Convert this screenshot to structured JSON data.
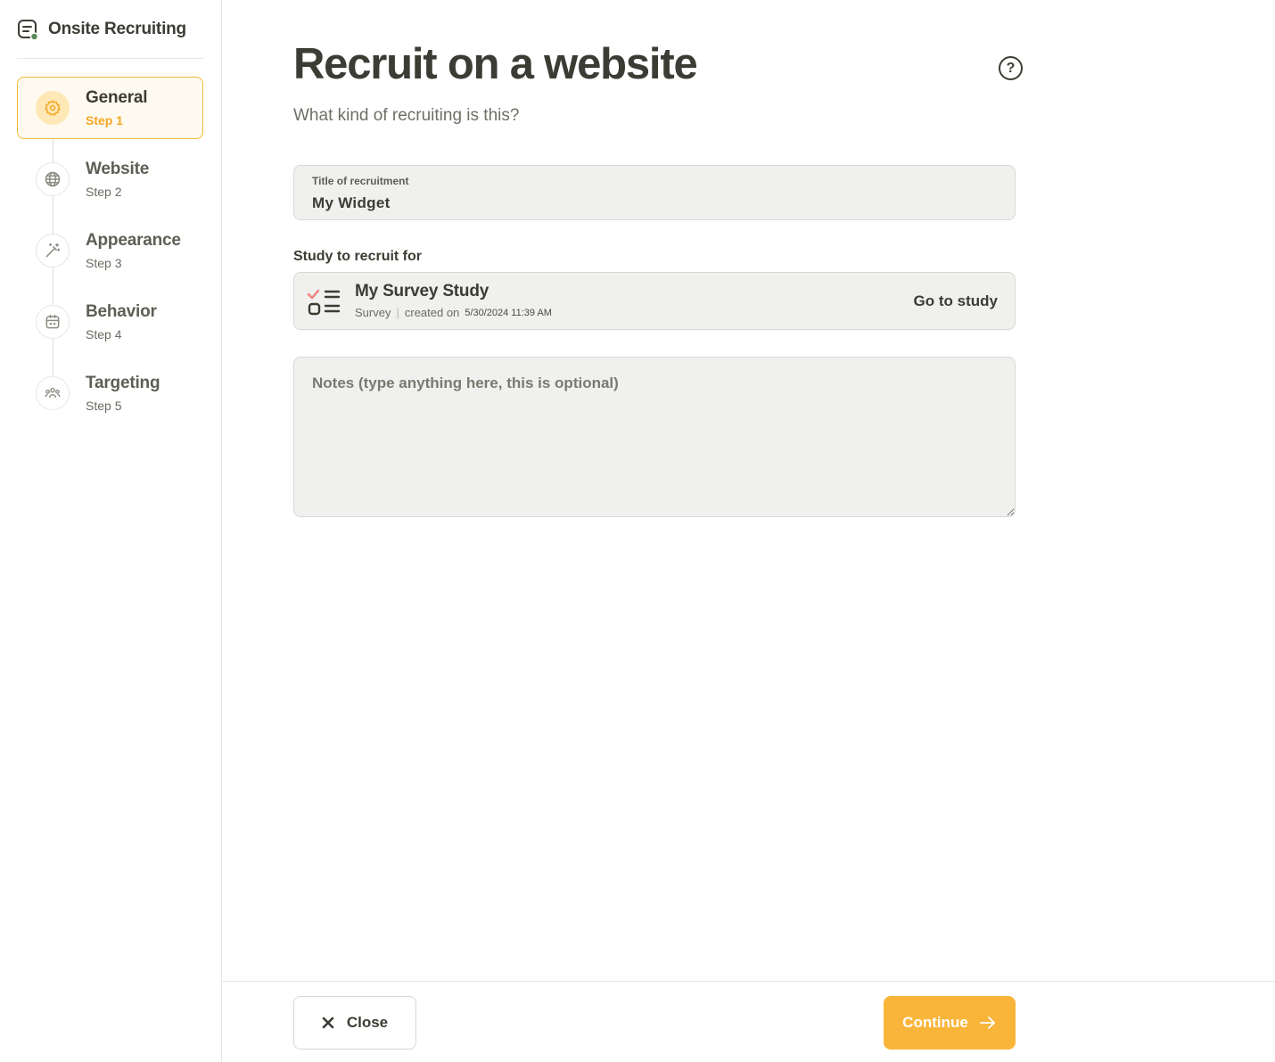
{
  "app": {
    "title": "Onsite Recruiting",
    "icon": "chat-form-icon"
  },
  "sidebar": {
    "steps": [
      {
        "name": "General",
        "sub": "Step 1",
        "icon": "gear-icon",
        "active": true
      },
      {
        "name": "Website",
        "sub": "Step 2",
        "icon": "globe-icon",
        "active": false
      },
      {
        "name": "Appearance",
        "sub": "Step 3",
        "icon": "magic-wand-icon",
        "active": false
      },
      {
        "name": "Behavior",
        "sub": "Step 4",
        "icon": "calendar-icon",
        "active": false
      },
      {
        "name": "Targeting",
        "sub": "Step 5",
        "icon": "people-group-icon",
        "active": false
      }
    ]
  },
  "main": {
    "title": "Recruit on a website",
    "subtitle": "What kind of recruiting is this?",
    "help_icon": "question-circle-icon",
    "title_field": {
      "label": "Title of recruitment",
      "value": "My Widget"
    },
    "study": {
      "label": "Study to recruit for",
      "name": "My Survey Study",
      "type": "Survey",
      "separator": "|",
      "created_prefix": "created on",
      "created_date": "5/30/2024 11:39 AM",
      "link": "Go to study",
      "icon": "survey-checklist-icon"
    },
    "notes": {
      "placeholder": "Notes (type anything here, this is optional)",
      "value": ""
    }
  },
  "footer": {
    "close_label": "Close",
    "continue_label": "Continue"
  },
  "colors": {
    "accent": "#f9b53a",
    "active_bg": "#fffaf0",
    "text": "#3c3c34",
    "field_bg": "#f0f0ee"
  }
}
